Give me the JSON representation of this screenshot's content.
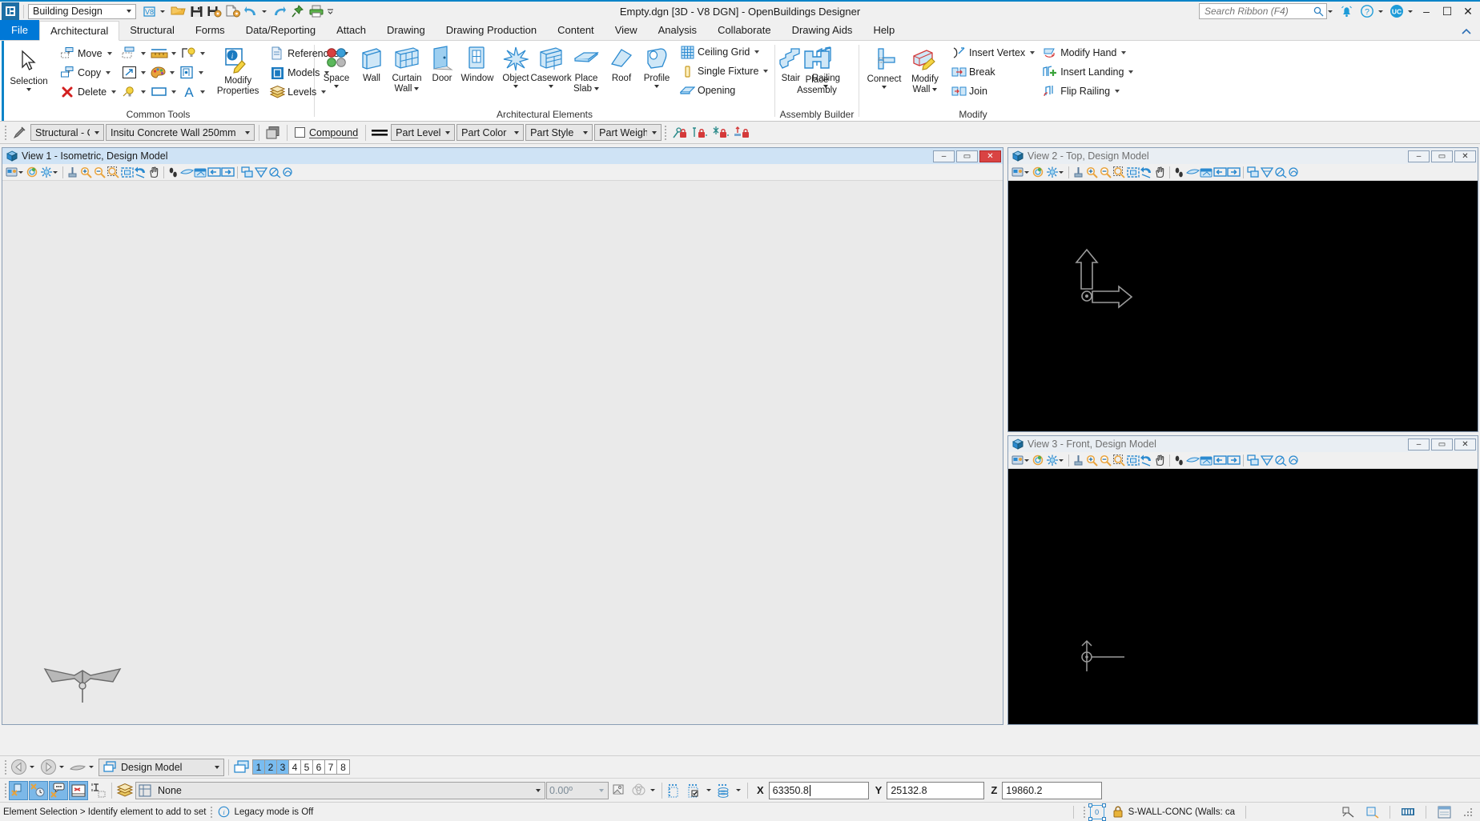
{
  "titlebar": {
    "workspace_value": "Building Design",
    "document_title": "Empty.dgn [3D - V8 DGN] - OpenBuildings Designer",
    "search_placeholder": "Search Ribbon (F4)",
    "user_initials": "UC",
    "quick_access": [
      {
        "name": "v8-format-icon",
        "label": "V8"
      },
      {
        "name": "open-folder-icon",
        "label": "Open"
      },
      {
        "name": "save-icon",
        "label": "Save"
      },
      {
        "name": "save-settings-icon",
        "label": "Save Settings"
      },
      {
        "name": "save-as-icon",
        "label": "Save As"
      },
      {
        "name": "undo-icon",
        "label": "Undo"
      },
      {
        "name": "redo-icon",
        "label": "Redo"
      },
      {
        "name": "pin-icon",
        "label": "Pin"
      },
      {
        "name": "print-icon",
        "label": "Print"
      }
    ],
    "window_buttons": {
      "minimize": "–",
      "maximize": "☐",
      "close": "✕"
    }
  },
  "ribbon": {
    "file_tab": "File",
    "tabs": [
      {
        "label": "Architectural",
        "active": true
      },
      {
        "label": "Structural",
        "active": false
      },
      {
        "label": "Forms",
        "active": false
      },
      {
        "label": "Data/Reporting",
        "active": false
      },
      {
        "label": "Attach",
        "active": false
      },
      {
        "label": "Drawing",
        "active": false
      },
      {
        "label": "Drawing Production",
        "active": false
      },
      {
        "label": "Content",
        "active": false
      },
      {
        "label": "View",
        "active": false
      },
      {
        "label": "Analysis",
        "active": false
      },
      {
        "label": "Collaborate",
        "active": false
      },
      {
        "label": "Drawing Aids",
        "active": false
      },
      {
        "label": "Help",
        "active": false
      }
    ],
    "groups": {
      "common_tools": {
        "label": "Common Tools",
        "selection": "Selection",
        "edit_items": [
          {
            "label": "Move",
            "icon": "move-icon"
          },
          {
            "label": "Copy",
            "icon": "copy-icon"
          },
          {
            "label": "Delete",
            "icon": "delete-icon"
          }
        ],
        "modify_properties": "Modify\nProperties",
        "modify_properties_line1": "Modify",
        "modify_properties_line2": "Properties",
        "right_items": [
          {
            "label": "References",
            "icon": "references-icon"
          },
          {
            "label": "Models",
            "icon": "models-icon"
          },
          {
            "label": "Levels",
            "icon": "levels-icon"
          }
        ]
      },
      "architectural_elements": {
        "label": "Architectural Elements",
        "big_buttons": [
          {
            "label": "Space",
            "icon": "space-icon",
            "dropdown": true
          },
          {
            "label": "Wall",
            "icon": "wall-icon",
            "dropdown": false
          },
          {
            "label": "Curtain Wall",
            "label1": "Curtain",
            "label2": "Wall",
            "icon": "curtain-wall-icon",
            "dropdown": true
          },
          {
            "label": "Door",
            "icon": "door-icon",
            "dropdown": false
          },
          {
            "label": "Window",
            "icon": "window-icon",
            "dropdown": false
          },
          {
            "label": "Object",
            "icon": "object-icon",
            "dropdown": true
          },
          {
            "label": "Casework",
            "icon": "casework-icon",
            "dropdown": true
          },
          {
            "label": "Place Slab",
            "label1": "Place",
            "label2": "Slab",
            "icon": "place-slab-icon",
            "dropdown": true
          },
          {
            "label": "Roof",
            "icon": "roof-icon",
            "dropdown": false
          },
          {
            "label": "Profile",
            "icon": "profile-icon",
            "dropdown": true
          },
          {
            "label": "Stair",
            "icon": "stair-icon",
            "dropdown": false
          },
          {
            "label": "Railing",
            "icon": "railing-icon",
            "dropdown": true
          }
        ],
        "small_items": [
          {
            "label": "Ceiling Grid",
            "icon": "ceiling-grid-icon",
            "dropdown": true
          },
          {
            "label": "Single Fixture",
            "icon": "single-fixture-icon",
            "dropdown": true
          },
          {
            "label": "Opening",
            "icon": "opening-icon",
            "dropdown": false
          }
        ]
      },
      "assembly_builder": {
        "label": "Assembly Builder",
        "place_assembly_line1": "Place",
        "place_assembly_line2": "Assembly"
      },
      "modify": {
        "label": "Modify",
        "connect": "Connect",
        "modify_wall_line1": "Modify",
        "modify_wall_line2": "Wall",
        "col1": [
          {
            "label": "Insert Vertex",
            "icon": "insert-vertex-icon",
            "dropdown": true
          },
          {
            "label": "Break",
            "icon": "break-icon",
            "dropdown": false
          },
          {
            "label": "Join",
            "icon": "join-icon",
            "dropdown": false
          }
        ],
        "col2": [
          {
            "label": "Modify Hand",
            "icon": "modify-hand-icon",
            "dropdown": true
          },
          {
            "label": "Insert Landing",
            "icon": "insert-landing-icon",
            "dropdown": true
          },
          {
            "label": "Flip Railing",
            "icon": "flip-railing-icon",
            "dropdown": true
          }
        ]
      }
    }
  },
  "attrbar": {
    "level": "Structural - C",
    "wall_type": "Insitu Concrete Wall 250mm",
    "compound_label": "Compound",
    "compound_checked": false,
    "part_level": "Part Level",
    "part_color": "Part Color",
    "part_style": "Part Style",
    "part_weight": "Part Weight"
  },
  "views": {
    "view1": {
      "title": "View 1 - Isometric, Design Model",
      "active": true,
      "canvas": "light",
      "buttons": {
        "minimize": "–",
        "maximize": "▭",
        "close": "✕"
      }
    },
    "view2": {
      "title": "View 2 - Top, Design Model",
      "active": false,
      "canvas": "dark",
      "buttons": {
        "minimize": "–",
        "maximize": "▭",
        "close": "✕"
      }
    },
    "view3": {
      "title": "View 3 - Front, Design Model",
      "active": false,
      "canvas": "dark",
      "buttons": {
        "minimize": "–",
        "maximize": "▭",
        "close": "✕"
      }
    },
    "toolbar_icons": [
      "view-attributes-icon",
      "view-attributes-dropdown",
      "adjust-view-icon",
      "view-display-icon",
      "display-dropdown",
      "update-view-icon",
      "zoom-in-icon",
      "zoom-out-icon",
      "window-area-icon",
      "fit-view-icon",
      "rotate-view-icon",
      "pan-view-icon",
      "walk-icon",
      "view-previous-icon",
      "view-next-icon",
      "view-back-icon",
      "view-forward-icon",
      "copy-view-icon",
      "clip-volume-icon",
      "clip-mask-icon",
      "clip-front-icon"
    ]
  },
  "modelbar": {
    "model_name": "Design Model",
    "levels": [
      {
        "n": "1",
        "on": true
      },
      {
        "n": "2",
        "on": true
      },
      {
        "n": "3",
        "on": true
      },
      {
        "n": "4",
        "on": false
      },
      {
        "n": "5",
        "on": false
      },
      {
        "n": "6",
        "on": false
      },
      {
        "n": "7",
        "on": false
      },
      {
        "n": "8",
        "on": false
      }
    ]
  },
  "toolbar2": {
    "snap_buttons": [
      {
        "name": "accusnap-icon",
        "on": true
      },
      {
        "name": "accudraw-icon",
        "on": true
      },
      {
        "name": "tooltip-icon",
        "on": true
      },
      {
        "name": "snap-divisor-icon",
        "on": true
      },
      {
        "name": "text-select-icon",
        "on": false
      }
    ],
    "level_display_label": "None",
    "angle_value": "0.00º",
    "coords": {
      "x_label": "X",
      "x_value": "63350.8",
      "y_label": "Y",
      "y_value": "25132.8",
      "z_label": "Z",
      "z_value": "19860.2"
    }
  },
  "statusbar": {
    "prompt": "Element Selection > Identify element to add to set",
    "legacy_mode": "Legacy mode is Off",
    "active_level": "S-WALL-CONC (Walls: ca"
  }
}
